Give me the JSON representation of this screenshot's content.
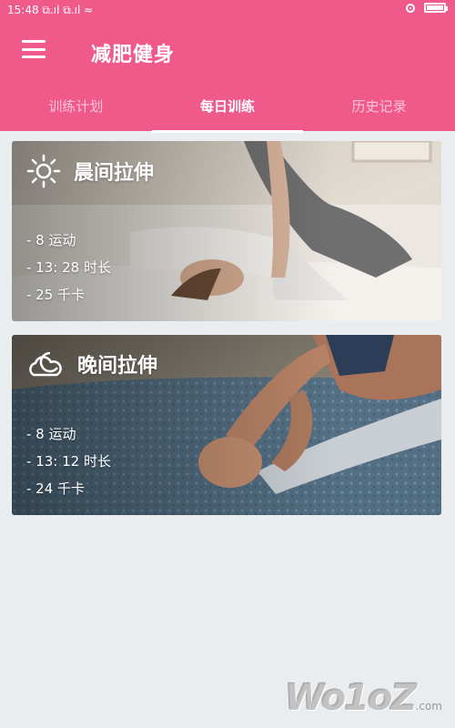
{
  "status_bar": {
    "time": "15:48",
    "signal_text": "⧉.ıl ⧉.ıl ≈"
  },
  "toolbar": {
    "title": "减肥健身"
  },
  "tabs": [
    {
      "label": "训练计划"
    },
    {
      "label": "每日训练",
      "active": true
    },
    {
      "label": "历史记录"
    }
  ],
  "cards": [
    {
      "title": "晨间拉伸",
      "icon": "sun-icon",
      "stats": [
        "- 8 运动",
        "- 13: 28 时长",
        "- 25 千卡"
      ]
    },
    {
      "title": "晚间拉伸",
      "icon": "moon-cloud-icon",
      "stats": [
        "- 8 运动",
        "- 13: 12 时长",
        "- 24 千卡"
      ]
    }
  ],
  "watermark": {
    "text": "Wo1oZ",
    "sub": ".com"
  },
  "colors": {
    "accent": "#f05a8b",
    "background": "#e9edf0"
  }
}
